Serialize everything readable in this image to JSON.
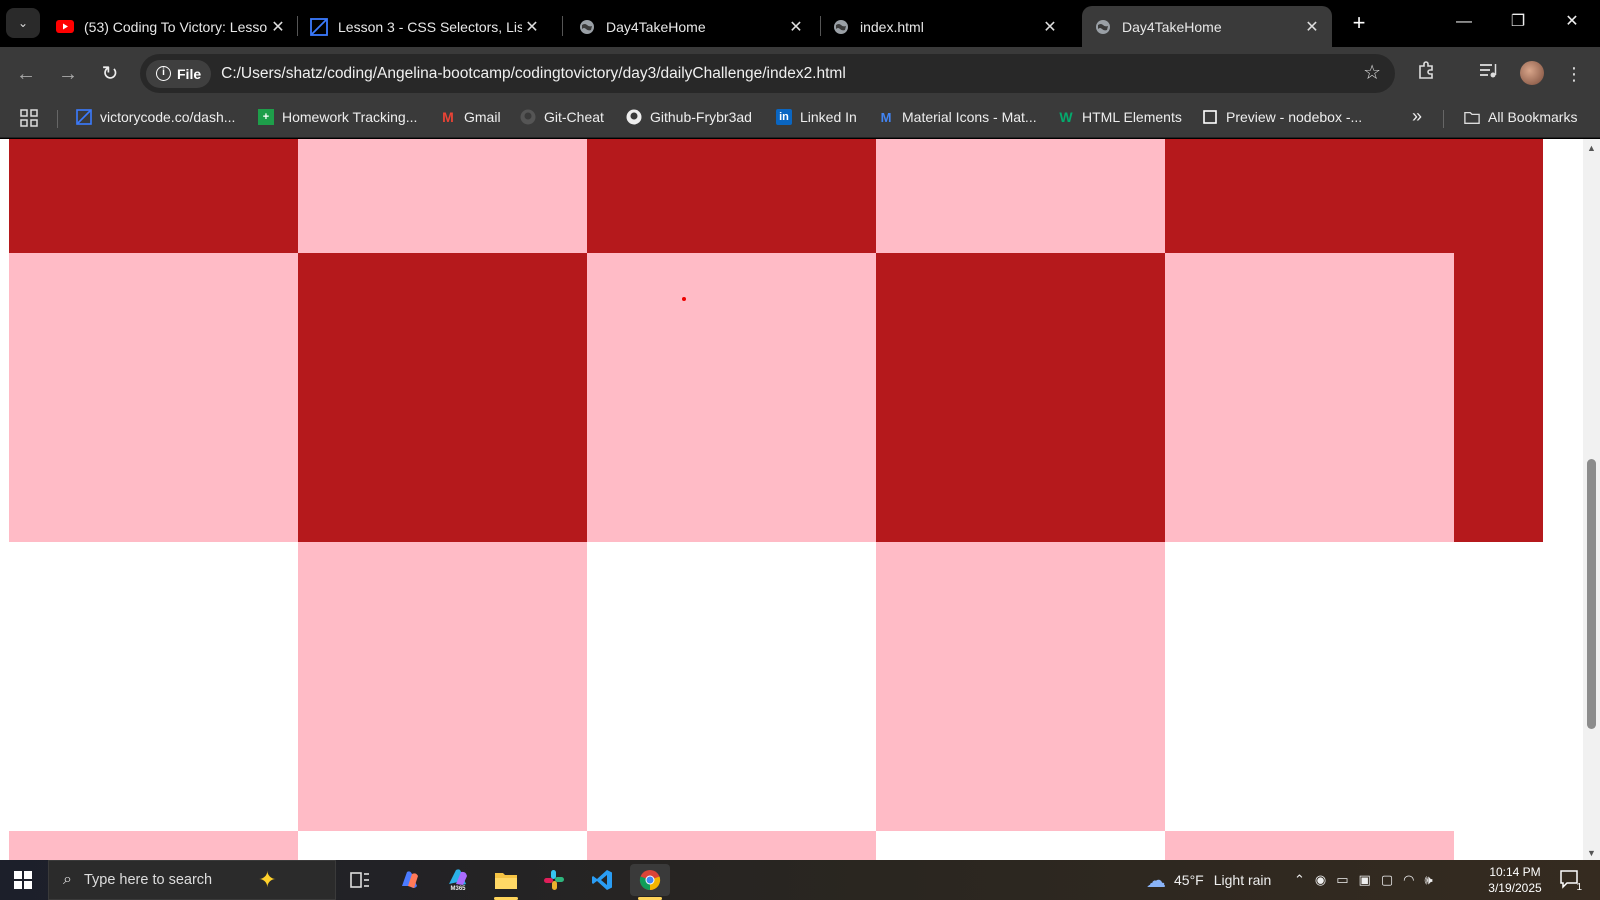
{
  "browser": {
    "tabs": [
      {
        "title": "(53) Coding To Victory: Lesso",
        "icon": "youtube-icon",
        "active": false
      },
      {
        "title": "Lesson 3 - CSS Selectors, Lis",
        "icon": "victorycode-icon",
        "active": false
      },
      {
        "title": "Day4TakeHome",
        "icon": "globe-icon",
        "active": false
      },
      {
        "title": "index.html",
        "icon": "globe-icon",
        "active": false
      },
      {
        "title": "Day4TakeHome",
        "icon": "globe-icon",
        "active": true
      }
    ],
    "close_glyph": "✕",
    "new_tab_glyph": "+",
    "window_controls": {
      "minimize": "—",
      "maximize": "❐",
      "close": "✕"
    },
    "address": {
      "scheme_chip": "File",
      "url": "C:/Users/shatz/coding/Angelina-bootcamp/codingtovictory/day3/dailyChallenge/index2.html"
    },
    "bookmarks": [
      {
        "label": "victorycode.co/dash...",
        "icon": "victorycode-icon"
      },
      {
        "label": "Homework Tracking...",
        "icon": "sheets-icon"
      },
      {
        "label": "Gmail",
        "icon": "gmail-icon"
      },
      {
        "label": "Git-Cheat",
        "icon": "github-icon"
      },
      {
        "label": "Github-Frybr3ad",
        "icon": "github-icon"
      },
      {
        "label": "Linked In",
        "icon": "linkedin-icon"
      },
      {
        "label": "Material Icons - Mat...",
        "icon": "material-icon"
      },
      {
        "label": "HTML Elements",
        "icon": "w3schools-icon"
      },
      {
        "label": "Preview - nodebox -...",
        "icon": "nodebox-icon"
      }
    ],
    "more_bookmarks": "»",
    "all_bookmarks": "All Bookmarks"
  },
  "page": {
    "colors": {
      "dark": "#b5191c",
      "pink": "#ffbbc6",
      "white": "#ffffff"
    },
    "rows": [
      [
        "dark",
        "pink",
        "dark",
        "pink",
        "dark",
        "dark"
      ],
      [
        "pink",
        "dark",
        "pink",
        "dark",
        "pink",
        "dark"
      ],
      [
        "white",
        "pink",
        "white",
        "pink",
        "white",
        "white"
      ],
      [
        "pink",
        "white",
        "pink",
        "white",
        "pink",
        "white"
      ]
    ]
  },
  "taskbar": {
    "search_placeholder": "Type here to search",
    "apps": [
      "task-view",
      "copilot",
      "m365",
      "file-explorer",
      "slack",
      "vscode",
      "chrome"
    ],
    "m365_label": "M365",
    "weather": {
      "temp": "45°F",
      "condition": "Light rain"
    },
    "time": "10:14 PM",
    "date": "3/19/2025",
    "notification_count": "1"
  }
}
